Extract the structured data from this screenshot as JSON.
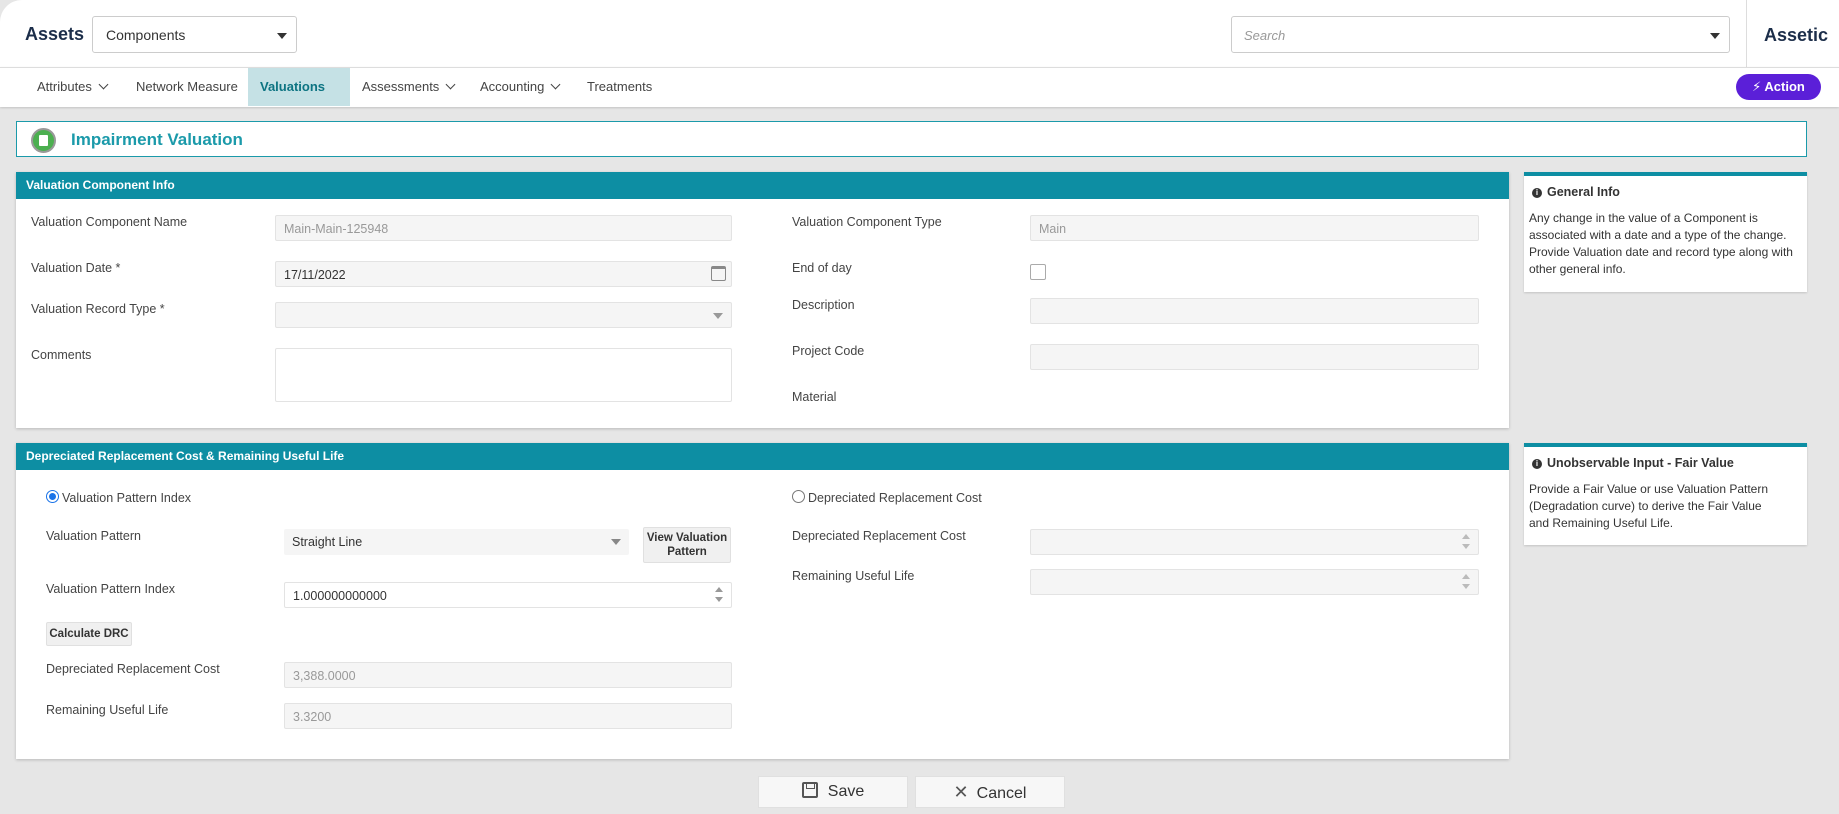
{
  "header": {
    "brand": "Assets",
    "context_select": "Components",
    "search_placeholder": "Search",
    "right_brand": "Assetic"
  },
  "nav": {
    "items": [
      {
        "label": "Attributes"
      },
      {
        "label": "Network Measure"
      },
      {
        "label": "Valuations"
      },
      {
        "label": "Assessments"
      },
      {
        "label": "Accounting"
      },
      {
        "label": "Treatments"
      }
    ],
    "active": "Valuations",
    "action_label": "Action"
  },
  "page": {
    "title": "Impairment Valuation"
  },
  "info_section": {
    "header": "Valuation Component Info",
    "labels": {
      "component_name": "Valuation Component Name",
      "valuation_date": "Valuation Date *",
      "record_type": "Valuation Record Type *",
      "comments": "Comments",
      "component_type": "Valuation Component Type",
      "end_of_day": "End of day",
      "description": "Description",
      "project_code": "Project Code",
      "material": "Material"
    },
    "values": {
      "component_name": "Main-Main-125948",
      "valuation_date": "17/11/2022",
      "record_type": "",
      "comments": "",
      "component_type": "Main",
      "end_of_day": false,
      "description": "",
      "project_code": ""
    }
  },
  "drc_section": {
    "header": "Depreciated Replacement Cost & Remaining Useful Life",
    "radio_index_label": "Valuation Pattern Index",
    "radio_drc_label": "Depreciated Replacement Cost",
    "selected_radio": "Valuation Pattern Index",
    "labels": {
      "pattern": "Valuation Pattern",
      "pattern_index": "Valuation Pattern Index",
      "drc_left": "Depreciated Replacement Cost",
      "rul_left": "Remaining Useful Life",
      "drc_right": "Depreciated Replacement Cost",
      "rul_right": "Remaining Useful Life"
    },
    "values": {
      "pattern": "Straight Line",
      "pattern_index": "1.000000000000",
      "drc_left": "3,388.0000",
      "rul_left": "3.3200",
      "drc_right": "",
      "rul_right": ""
    },
    "view_pattern_button": "View Valuation Pattern",
    "calculate_button": "Calculate DRC"
  },
  "side_info": [
    {
      "title": "General Info",
      "text": "Any change in the value of a Component is associated with a date and a type of the change. Provide Valuation date and record type along with other general info."
    },
    {
      "title": "Unobservable Input - Fair Value",
      "text": "Provide a Fair Value or use Valuation Pattern (Degradation curve) to derive the Fair Value and Remaining Useful Life."
    }
  ],
  "footer": {
    "save_label": "Save",
    "cancel_label": "Cancel"
  },
  "colors": {
    "accent": "#0d8ea3",
    "action": "#5b1fd8",
    "title": "#1b9aaa"
  }
}
